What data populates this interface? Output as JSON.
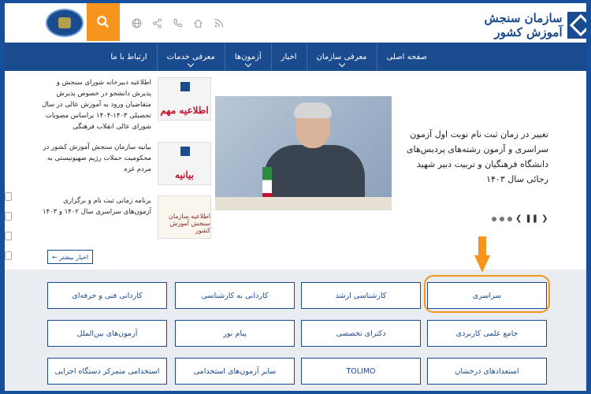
{
  "header": {
    "org_name": "سازمان سنجش آموزش کشور",
    "icons": [
      "rss-icon",
      "home-icon",
      "phone-icon",
      "share-icon",
      "globe-icon"
    ]
  },
  "nav": {
    "items": [
      {
        "label": "صفحه اصلی"
      },
      {
        "label": "معرفی سازمان"
      },
      {
        "label": "اخبار"
      },
      {
        "label": "آزمون‌ها"
      },
      {
        "label": "معرفی خدمات"
      },
      {
        "label": "ارتباط با ما"
      }
    ]
  },
  "news": [
    {
      "thumb": "اطلاعیه مهم",
      "text": "اطلاعیه دبیرخانه شورای سنجش و پذیرش دانشجو در خصوص پذیرش متقاضیان ورود به آموزش عالی در سال تحصیلی ۱۴۰۳-۱۴۰۴ براساس مصوبات شورای عالی انقلاب فرهنگی"
    },
    {
      "thumb": "بیانیه",
      "text": "بیانیه سازمان سنجش آموزش کشور در محکومیت حملات رژیم صهیونیستی به مردم غزه"
    },
    {
      "thumb": "اطلاعیه سازمان سنجش آموزش کشور",
      "text": "برنامه زمانی ثبت نام و برگزاری آزمون‌های سراسری سال ۱۴۰۲ و ۱۴۰۳"
    }
  ],
  "hero": {
    "title": "تغییر در زمان ثبت نام نوبت اول آزمون سراسری و آزمون رشته‌های پردیس‌های دانشگاه فرهنگیان و تربیت دبیر شهید رجائی سال ۱۴۰۳"
  },
  "more_button": "اخبار بیشتر ←",
  "tiles": [
    [
      "سراسری",
      "کارشناسی ارشد",
      "کاردانی به کارشناسی",
      "کاردانی فنی و حرفه‌ای"
    ],
    [
      "جامع علمی کاربردی",
      "دکترای تخصصی",
      "پیام نور",
      "آزمون‌های بین‌الملل"
    ],
    [
      "استعدادهای درخشان",
      "TOLIMO",
      "سایر آزمون‌های استخدامی",
      "استخدامی متمرکز دستگاه اجرایی"
    ]
  ],
  "colors": {
    "primary": "#1b4b8f",
    "accent": "#f7941d"
  }
}
